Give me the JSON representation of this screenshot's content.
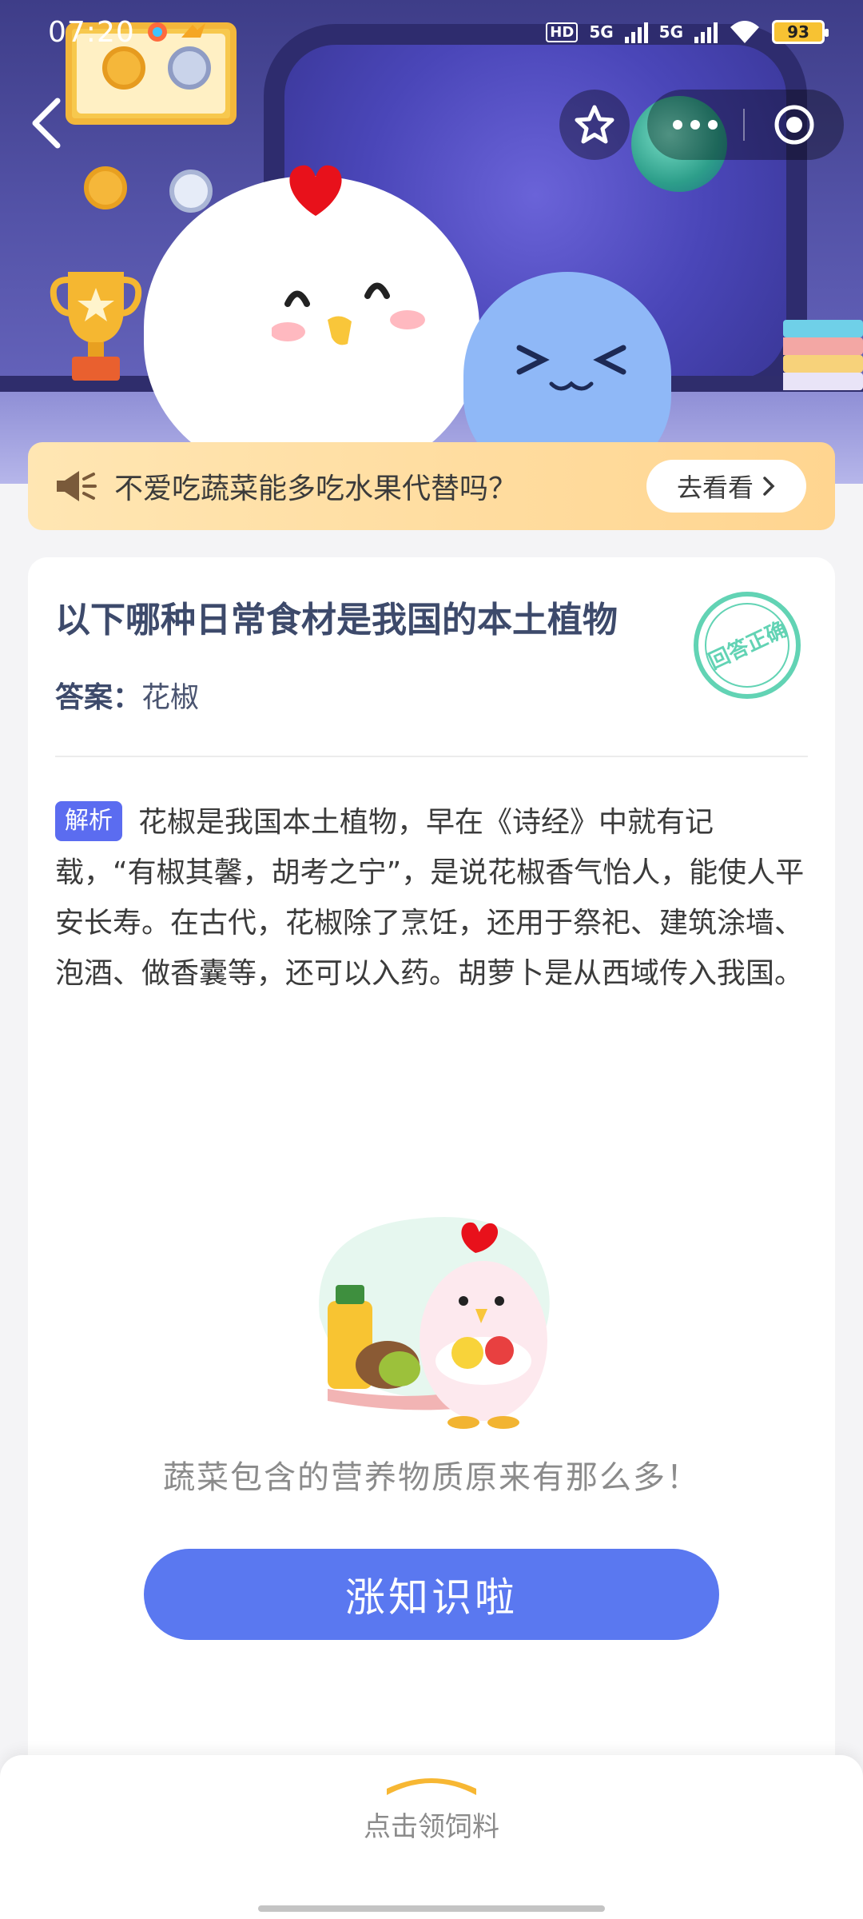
{
  "status_bar": {
    "time": "07:20",
    "network_1": "5G",
    "network_2": "5G",
    "hd_label": "HD",
    "battery": "93"
  },
  "nav": {
    "back_icon": "chevron-left-icon",
    "star_icon": "star-outline-icon",
    "more_icon": "more-dots-icon",
    "close_icon": "target-circle-icon"
  },
  "tip_banner": {
    "text": "不爱吃蔬菜能多吃水果代替吗？",
    "button_label": "去看看"
  },
  "card": {
    "question": "以下哪种日常食材是我国的本土植物",
    "stamp_text": "回答正确",
    "answer_label": "答案：",
    "answer_value": "花椒",
    "analysis_tag": "解析",
    "analysis_text": "花椒是我国本土植物，早在《诗经》中就有记载，“有椒其馨，胡考之宁”，是说花椒香气怡人，能使人平安长寿。在古代，花椒除了烹饪，还用于祭祀、建筑涂墙、泡酒、做香囊等，还可以入药。胡萝卜是从西域传入我国。",
    "promo_text": "蔬菜包含的营养物质原来有那么多！",
    "learn_button": "涨知识啦"
  },
  "bottom": {
    "text": "点击领饲料"
  },
  "colors": {
    "accent": "#5a78f0",
    "tag": "#5b6cf0",
    "banner": "#ffd590",
    "stamp": "#62d3b4"
  }
}
